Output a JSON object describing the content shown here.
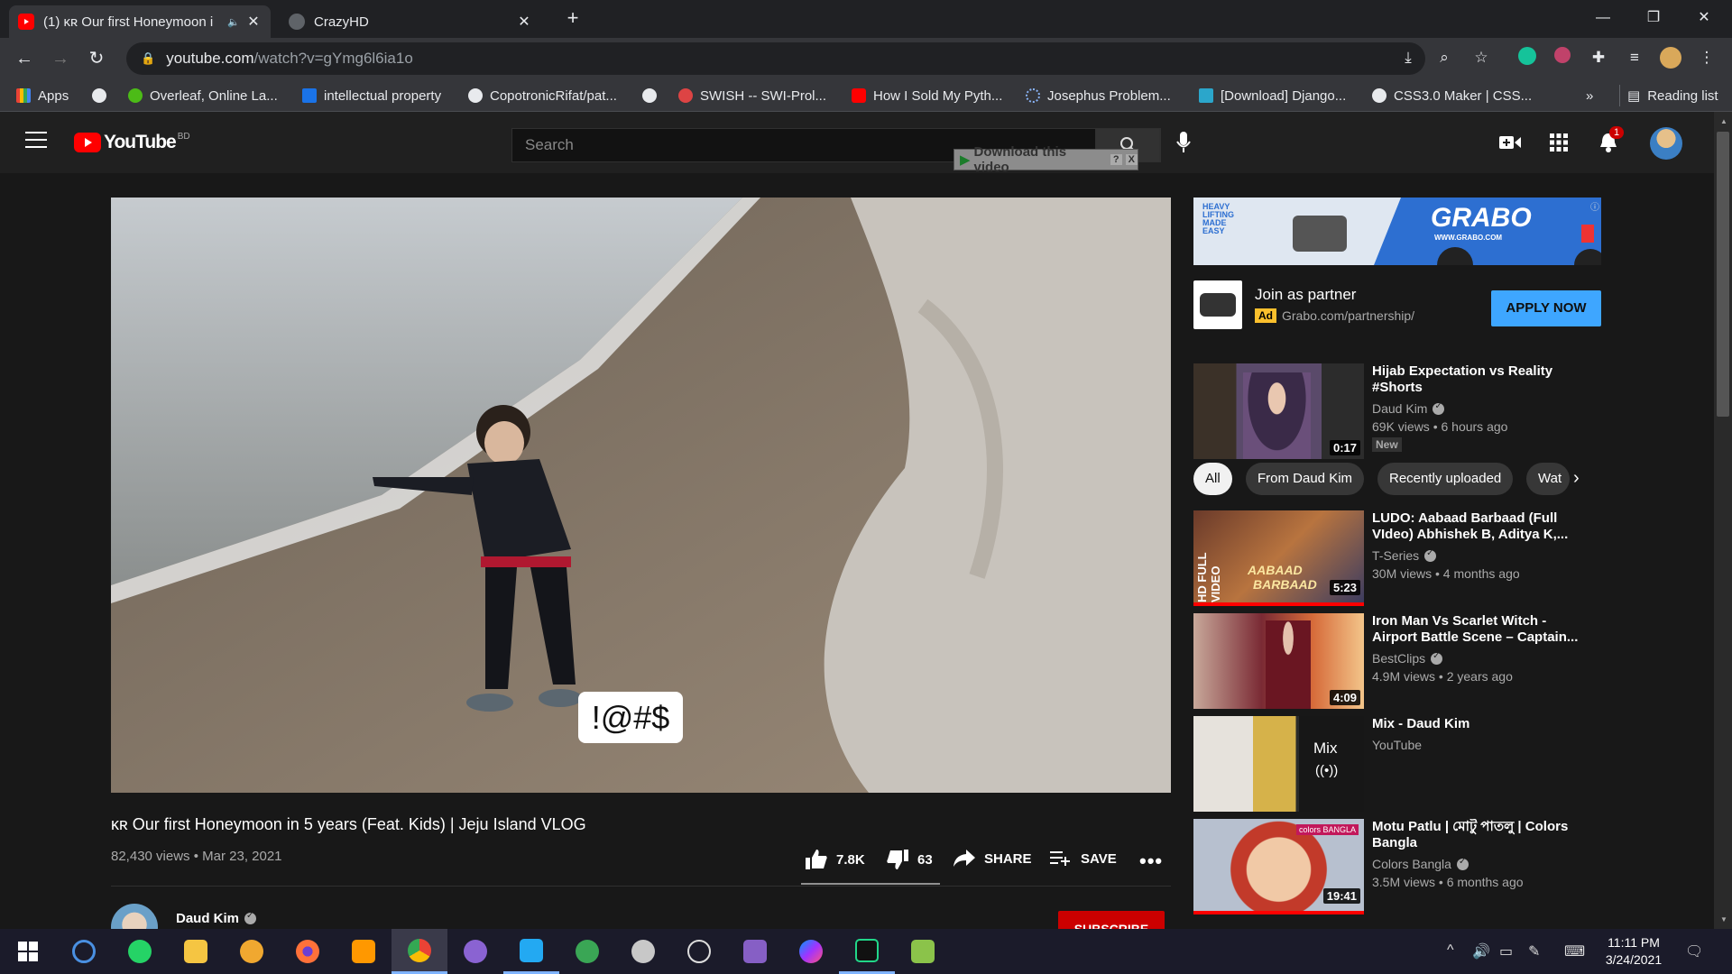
{
  "browser": {
    "tabs": [
      {
        "title": "(1) ᴋʀ Our first Honeymoon i",
        "favicon": "youtube-icon",
        "active": true
      },
      {
        "title": "CrazyHD",
        "favicon": "globe-icon",
        "active": false
      }
    ],
    "url_host": "youtube.com",
    "url_path": "/watch?v=gYmg6l6ia1o",
    "bookmarks": [
      {
        "label": "Apps",
        "icon": "apps-grid-icon"
      },
      {
        "label": "",
        "icon": "globe-icon"
      },
      {
        "label": "Overleaf, Online La...",
        "icon": "overleaf-icon"
      },
      {
        "label": "intellectual property",
        "icon": "s-icon"
      },
      {
        "label": "CopotronicRifat/pat...",
        "icon": "github-icon"
      },
      {
        "label": "",
        "icon": "globe-icon"
      },
      {
        "label": "SWISH -- SWI-Prol...",
        "icon": "swish-icon"
      },
      {
        "label": "How I Sold My Pyth...",
        "icon": "youtube-icon"
      },
      {
        "label": "Josephus Problem...",
        "icon": "loading-icon"
      },
      {
        "label": "[Download] Django...",
        "icon": "django-icon"
      },
      {
        "label": "CSS3.0 Maker | CSS...",
        "icon": "globe-icon"
      }
    ],
    "more_bookmarks": "»",
    "reading_list": "Reading list"
  },
  "youtube": {
    "logo_text": "YouTube",
    "country": "BD",
    "search_placeholder": "Search",
    "download_bar": "Download this video",
    "download_bar_help": "?",
    "download_bar_close": "X",
    "notifications_count": "1"
  },
  "video": {
    "overlay_text": "!@#$",
    "title": "ᴋʀ Our first Honeymoon in 5 years (Feat. Kids) | Jeju Island VLOG",
    "views_date": "82,430 views • Mar 23, 2021",
    "likes": "7.8K",
    "dislikes": "63",
    "share": "SHARE",
    "save": "SAVE",
    "channel": "Daud Kim",
    "subscribe": "SUBSCRIBE"
  },
  "ad": {
    "banner_brand": "GRABO",
    "banner_url": "WWW.GRABO.COM",
    "banner_slogan": [
      "HEAVY",
      "LIFTING",
      "MADE",
      "EASY"
    ],
    "title": "Join as partner",
    "badge": "Ad",
    "url": "Grabo.com/partnership/",
    "cta": "APPLY NOW"
  },
  "chips": [
    "All",
    "From Daud Kim",
    "Recently uploaded",
    "Wat"
  ],
  "related": [
    {
      "title": "Hijab Expectation vs Reality #Shorts",
      "channel": "Daud Kim",
      "meta": "69K views • 6 hours ago",
      "duration": "0:17",
      "badge": "New"
    },
    {
      "title": "LUDO: Aabaad Barbaad (Full VIdeo) Abhishek B, Aditya K,...",
      "channel": "T-Series",
      "meta": "30M views • 4 months ago",
      "duration": "5:23",
      "thumb_text": [
        "HD FULL VIDEO",
        "AABAAD",
        "BARBAAD"
      ]
    },
    {
      "title": "Iron Man Vs Scarlet Witch - Airport Battle Scene – Captain...",
      "channel": "BestClips",
      "meta": "4.9M views • 2 years ago",
      "duration": "4:09"
    },
    {
      "title": "Mix - Daud Kim",
      "channel": "YouTube",
      "meta": "",
      "duration": "",
      "mix_label": "Mix"
    },
    {
      "title": "Motu Patlu | মোটু পাতলু | Colors Bangla",
      "channel": "Colors Bangla",
      "meta": "3.5M views • 6 months ago",
      "duration": "19:41",
      "thumb_text": [
        "colors BANGLA"
      ]
    }
  ],
  "taskbar": {
    "time": "11:11 PM",
    "date": "3/24/2021"
  },
  "colors": {
    "yt_red": "#ff0000",
    "accent_blue": "#3ea6ff",
    "background": "#181818"
  }
}
